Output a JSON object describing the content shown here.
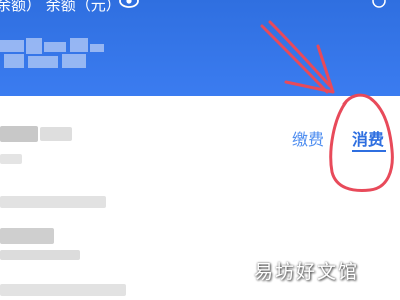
{
  "status_bar": {
    "top_text": "余额）  余额（元）",
    "icon_eye": "eye-icon",
    "icon_corner": "help-icon"
  },
  "header": {
    "amount_masked": "mosaic"
  },
  "tabs": [
    {
      "label": "缴费",
      "selected": false
    },
    {
      "label": "消费",
      "selected": true
    }
  ],
  "colors": {
    "header_blue": "#3b7cf0",
    "tab_active": "#2f6fe0",
    "annotation_red": "#e84a5a"
  },
  "watermark": "易坊好文馆"
}
